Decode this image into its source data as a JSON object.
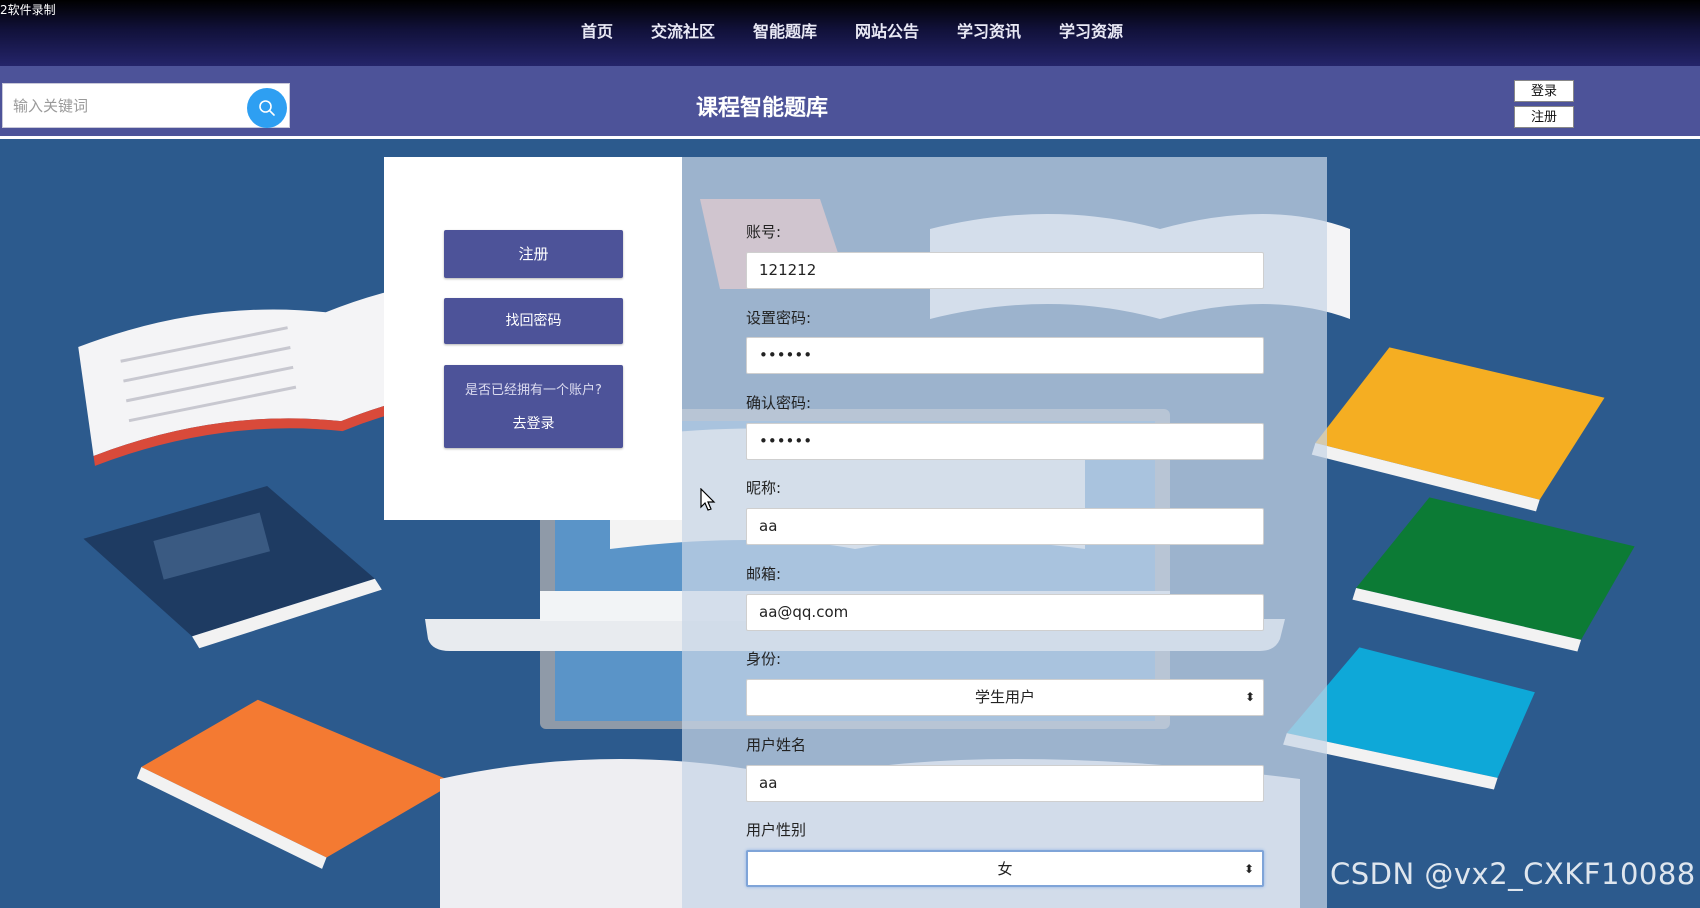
{
  "recorder_label": "2软件录制",
  "nav": {
    "items": [
      "首页",
      "交流社区",
      "智能题库",
      "网站公告",
      "学习资讯",
      "学习资源"
    ]
  },
  "header": {
    "search_placeholder": "输入关键词",
    "title": "课程智能题库",
    "login_label": "登录",
    "register_label": "注册"
  },
  "left_panel": {
    "register_label": "注册",
    "recover_label": "找回密码",
    "has_account_text": "是否已经拥有一个账户?",
    "go_login_label": "去登录"
  },
  "form": {
    "account_label": "账号:",
    "account_value": "121212",
    "password_label": "设置密码:",
    "password_value": "••••••",
    "confirm_label": "确认密码:",
    "confirm_value": "••••••",
    "nickname_label": "昵称:",
    "nickname_value": "aa",
    "email_label": "邮箱:",
    "email_value": "aa@qq.com",
    "role_label": "身份:",
    "role_value": "学生用户",
    "realname_label": "用户姓名",
    "realname_value": "aa",
    "gender_label": "用户性别",
    "gender_value": "女"
  },
  "watermark": "CSDN @vx2_CXKF10088",
  "colors": {
    "nav_bg": "#11113a",
    "header_bg": "#4d5399",
    "button_bg": "#4d5399",
    "search_button": "#2e9ff2",
    "scene_bg": "#2c5a8d"
  }
}
